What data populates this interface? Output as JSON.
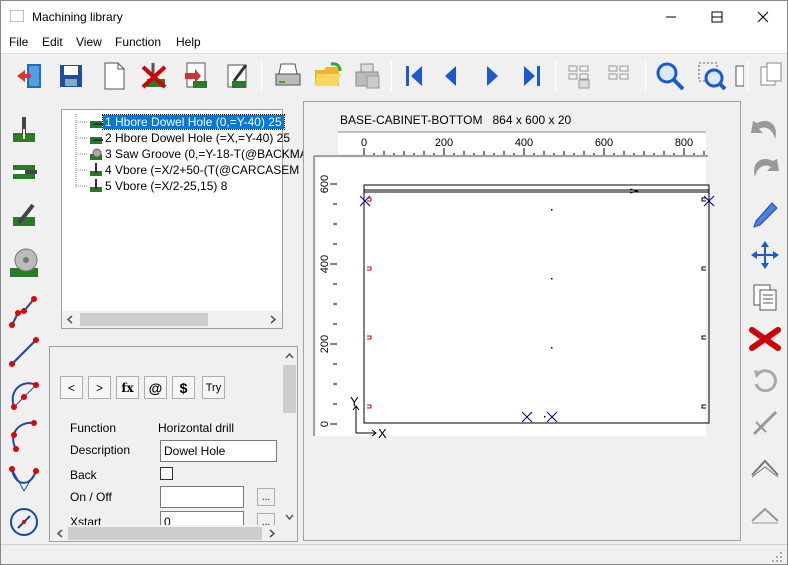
{
  "window": {
    "title": "Machining library"
  },
  "menu": [
    "File",
    "Edit",
    "View",
    "Function",
    "Help"
  ],
  "toolbar": {
    "icons": [
      "exit-icon",
      "save-icon",
      "new-icon",
      "delete-icon",
      "import-icon",
      "edit-icon",
      "print-icon",
      "open-folder-icon",
      "print-preview-icon",
      "first-icon",
      "previous-icon",
      "next-icon",
      "last-icon",
      "pattern-icon",
      "pattern-2-icon",
      "zoom-icon",
      "zoom-window-icon",
      "copy-icon"
    ]
  },
  "tree": {
    "items": [
      {
        "label": "1 Hbore Dowel Hole (0,=Y-40) 25",
        "icon": "hbore-icon",
        "selected": true
      },
      {
        "label": "2 Hbore Dowel Hole (=X,=Y-40) 25",
        "icon": "hbore-icon",
        "selected": false
      },
      {
        "label": "3 Saw Groove (0,=Y-18-T(@BACKMA",
        "icon": "saw-icon",
        "selected": false
      },
      {
        "label": "4 Vbore  (=X/2+50-(T(@CARCASEM",
        "icon": "vbore-icon",
        "selected": false
      },
      {
        "label": "5 Vbore  (=X/2-25,15) 8",
        "icon": "vbore-icon",
        "selected": false
      }
    ]
  },
  "props": {
    "buttons": [
      "<",
      ">",
      "fx",
      "@",
      "$",
      "Try"
    ],
    "function_label": "Function",
    "function_value": "Horizontal drill",
    "description_label": "Description",
    "description_value": "Dowel Hole",
    "back_label": "Back",
    "onoff_label": "On / Off",
    "onoff_value": "",
    "xstart_label": "Xstart",
    "xstart_value": "0",
    "ellipsis": "..."
  },
  "canvas": {
    "caption": "BASE-CABINET-BOTTOM   864 x 600 x 20",
    "ruler_x": [
      "0",
      "200",
      "400",
      "600",
      "800"
    ],
    "ruler_y": [
      "600",
      "400",
      "200",
      "0"
    ],
    "axis_x": "X",
    "axis_y": "Y"
  },
  "colors": {
    "accent": "#0078d7",
    "drawing": "#000080",
    "marker": "#c00000"
  }
}
